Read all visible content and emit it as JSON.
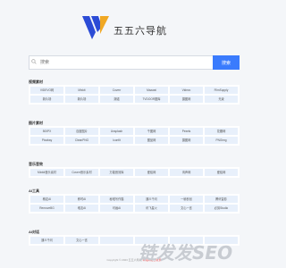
{
  "site": {
    "title": "五五六导航"
  },
  "search": {
    "placeholder": "搜索",
    "button": "搜索"
  },
  "sections": [
    {
      "title": "视频素材",
      "items": [
        "VIDEVO网",
        "Mixkit",
        "Coverr",
        "Mazwai",
        "Videvo",
        "FilmSupply",
        "新片场",
        "新片场",
        "潮诺",
        "TVDOOR图库",
        "摄图网",
        "光束",
        "新片场",
        "",
        "",
        "",
        "",
        ""
      ]
    },
    {
      "title": "图片素材",
      "items": [
        "500PX",
        "百度图片",
        "Unsplash",
        "千图网",
        "Pexels",
        "花瓣网",
        "Pixabay",
        "CleanPNG",
        "Iconfit",
        "图品网",
        "摄图网",
        "PNGimg"
      ]
    },
    {
      "title": "音乐音效",
      "items": [
        "Mixkit音乐素材",
        "Coverr音乐素材",
        "万能音效库",
        "爱给网",
        "淘声网",
        "爱给网"
      ]
    },
    {
      "title": "AI工具",
      "items": [
        "稿定AI",
        "即时AI",
        "秘塔写作猫",
        "通义千问",
        "一帧秒创",
        "腾讯智影",
        "RemoveBG",
        "堆友AI",
        "可画AI",
        "讯飞星火",
        "文心一言",
        "必剪Studio"
      ]
    },
    {
      "title": "AI对话",
      "items": [
        "通义千问",
        "文心一言",
        "",
        "",
        "",
        ""
      ]
    }
  ],
  "footer": {
    "text": "Copyright © 2023 五五六导航",
    "link": "本站网址已收录"
  },
  "watermark": "链发发SEO",
  "colors": {
    "accent": "#3a7bfd",
    "cell_bg": "#e8f0fb",
    "logo_blue": "#2b4bd6",
    "logo_gold": "#f0a824"
  }
}
